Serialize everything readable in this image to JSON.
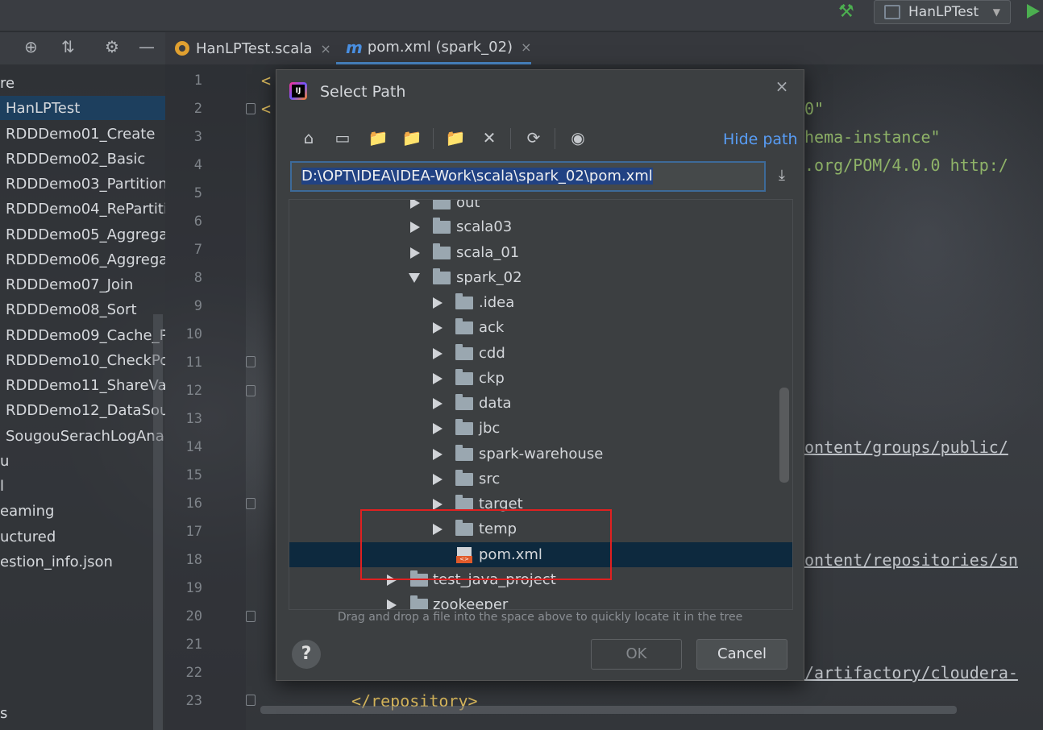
{
  "toolbar": {
    "run_config_label": "HanLPTest",
    "icons": [
      "hammer-icon",
      "run-icon",
      "target-icon",
      "collapse-icon",
      "gear-icon",
      "minimize-icon"
    ]
  },
  "tabs": [
    {
      "label": "HanLPTest.scala",
      "close": "×"
    },
    {
      "label": "pom.xml (spark_02)",
      "close": "×"
    }
  ],
  "sidebar": {
    "items": [
      {
        "label": "re"
      },
      {
        "label": "HanLPTest"
      },
      {
        "label": "RDDDemo01_Create"
      },
      {
        "label": "RDDDemo02_Basic"
      },
      {
        "label": "RDDDemo03_Partition"
      },
      {
        "label": "RDDDemo04_RePartiti"
      },
      {
        "label": "RDDDemo05_Aggrega"
      },
      {
        "label": "RDDDemo06_Aggrega"
      },
      {
        "label": "RDDDemo07_Join"
      },
      {
        "label": "RDDDemo08_Sort"
      },
      {
        "label": "RDDDemo09_Cache_Pe"
      },
      {
        "label": "RDDDemo10_CheckPo"
      },
      {
        "label": "RDDDemo11_ShareVar"
      },
      {
        "label": "RDDDemo12_DataSou"
      },
      {
        "label": "SougouSerachLogAnaly"
      },
      {
        "label": "u"
      },
      {
        "label": "l"
      },
      {
        "label": "eaming"
      },
      {
        "label": "uctured"
      },
      {
        "label": "estion_info.json"
      },
      {
        "label": "s"
      }
    ]
  },
  "editor": {
    "line_numbers": [
      "1",
      "2",
      "3",
      "4",
      "5",
      "6",
      "7",
      "8",
      "9",
      "10",
      "11",
      "12",
      "13",
      "14",
      "15",
      "16",
      "17",
      "18",
      "19",
      "20",
      "21",
      "22",
      "23"
    ],
    "fragments": {
      "l1": "<",
      "l2": "<",
      "l2_right": "0\"",
      "l3_right": "hema-instance\"",
      "l4_right": ".org/POM/4.0.0 http:/",
      "l14_right": "ontent/groups/public/",
      "l18_right": "ontent/repositories/sn",
      "l22_right": "/artifactory/cloudera-",
      "l23": "</repository>"
    }
  },
  "dialog": {
    "title": "Select Path",
    "hide_path_label": "Hide path",
    "path_value": "D:\\OPT\\IDEA\\IDEA-Work\\scala\\spark_02\\pom.xml",
    "tree": [
      {
        "label": "out",
        "kind": "folder",
        "state": "collapsed",
        "depth": 0
      },
      {
        "label": "scala03",
        "kind": "folder",
        "state": "collapsed",
        "depth": 0
      },
      {
        "label": "scala_01",
        "kind": "folder",
        "state": "collapsed",
        "depth": 0
      },
      {
        "label": "spark_02",
        "kind": "folder",
        "state": "expanded",
        "depth": 0
      },
      {
        "label": ".idea",
        "kind": "folder",
        "state": "collapsed",
        "depth": 1
      },
      {
        "label": "ack",
        "kind": "folder",
        "state": "collapsed",
        "depth": 1
      },
      {
        "label": "cdd",
        "kind": "folder",
        "state": "collapsed",
        "depth": 1
      },
      {
        "label": "ckp",
        "kind": "folder",
        "state": "collapsed",
        "depth": 1
      },
      {
        "label": "data",
        "kind": "folder",
        "state": "collapsed",
        "depth": 1
      },
      {
        "label": "jbc",
        "kind": "folder",
        "state": "collapsed",
        "depth": 1
      },
      {
        "label": "spark-warehouse",
        "kind": "folder",
        "state": "collapsed",
        "depth": 1
      },
      {
        "label": "src",
        "kind": "folder",
        "state": "collapsed",
        "depth": 1
      },
      {
        "label": "target",
        "kind": "folder",
        "state": "collapsed",
        "depth": 1
      },
      {
        "label": "temp",
        "kind": "folder",
        "state": "collapsed",
        "depth": 1
      },
      {
        "label": "pom.xml",
        "kind": "file",
        "state": "selected",
        "depth": 1
      },
      {
        "label": "test_java_project",
        "kind": "folder",
        "state": "collapsed",
        "depth": -1
      },
      {
        "label": "zookeeper",
        "kind": "folder",
        "state": "collapsed",
        "depth": -1
      }
    ],
    "hint": "Drag and drop a file into the space above to quickly locate it in the tree",
    "help_label": "?",
    "ok_label": "OK",
    "cancel_label": "Cancel",
    "close_label": "×"
  },
  "colors": {
    "accent": "#589df6",
    "selection": "#0d293e",
    "highlight_box": "#e02020"
  }
}
